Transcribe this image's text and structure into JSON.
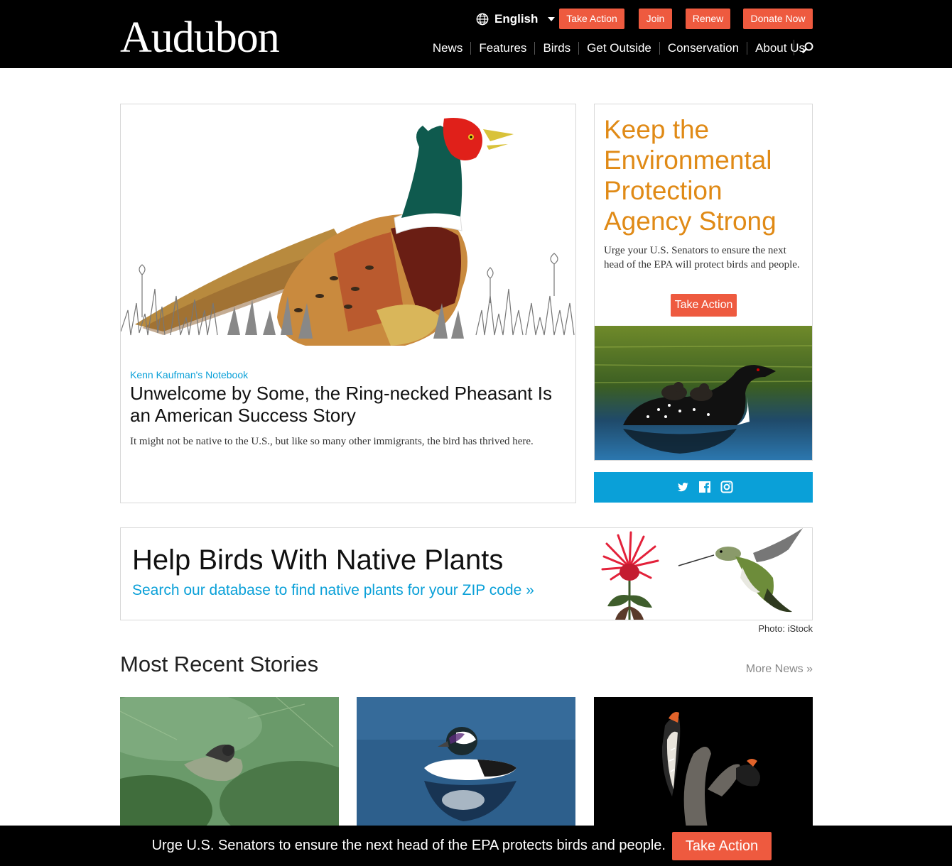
{
  "header": {
    "logo": "Audubon",
    "language": "English",
    "buttons": [
      "Take Action",
      "Join",
      "Renew",
      "Donate Now"
    ],
    "nav": [
      "News",
      "Features",
      "Birds",
      "Get Outside",
      "Conservation",
      "About Us"
    ],
    "search_icon": "search-icon",
    "globe_icon": "globe-icon"
  },
  "feature": {
    "kicker": "Kenn Kaufman's Notebook",
    "title": "Unwelcome by Some, the Ring-necked Pheasant Is an American Success Story",
    "dek": "It might not be native to the U.S., but like so many other immigrants, the bird has thrived here."
  },
  "campaign": {
    "title": "Keep the Environmental Protection Agency Strong",
    "text": "Urge your U.S. Senators to ensure the next head of the EPA will protect birds and people.",
    "button": "Take Action",
    "accent": "#e08a16"
  },
  "social": {
    "icons": [
      "twitter-icon",
      "facebook-icon",
      "instagram-icon"
    ],
    "color": "#0aa0d8"
  },
  "plants": {
    "title": "Help Birds With Native Plants",
    "link": "Search our database to find native plants for your ZIP code »",
    "credit": "Photo: iStock"
  },
  "recent": {
    "title": "Most Recent Stories",
    "more": "More News »"
  },
  "sticky": {
    "text": "Urge U.S. Senators to ensure the next head of the EPA protects birds and people.",
    "button": "Take Action"
  },
  "colors": {
    "brand_red": "#ee5a3f",
    "link_blue": "#0aa0d8"
  }
}
